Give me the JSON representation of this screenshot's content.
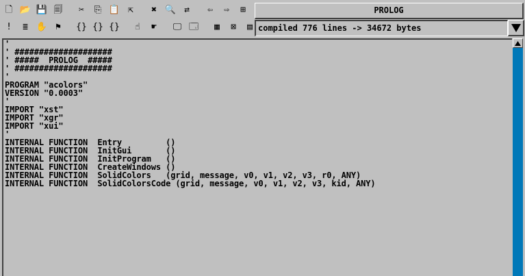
{
  "toolbar": {
    "row1": [
      {
        "name": "new-file-icon",
        "glyph": "🗋"
      },
      {
        "name": "open-folder-icon",
        "glyph": "📂"
      },
      {
        "name": "save-icon",
        "glyph": "💾"
      },
      {
        "name": "save-all-icon",
        "glyph": "🗐"
      },
      {
        "name": "cut-icon",
        "glyph": "✂"
      },
      {
        "name": "copy-icon",
        "glyph": "⎘"
      },
      {
        "name": "paste-icon",
        "glyph": "📋"
      },
      {
        "name": "export-icon",
        "glyph": "⇱"
      },
      {
        "name": "delete-icon",
        "glyph": "✖"
      },
      {
        "name": "find-icon",
        "glyph": "🔍"
      },
      {
        "name": "replace-icon",
        "glyph": "⇄"
      },
      {
        "name": "back-icon",
        "glyph": "⇦"
      },
      {
        "name": "forward-icon",
        "glyph": "⇨"
      },
      {
        "name": "tree-icon",
        "glyph": "⊞"
      }
    ],
    "row2": [
      {
        "name": "abort-icon",
        "glyph": "!"
      },
      {
        "name": "list-icon",
        "glyph": "≣"
      },
      {
        "name": "hand-stop-icon",
        "glyph": "✋"
      },
      {
        "name": "breakpoint-icon",
        "glyph": "⚑"
      },
      {
        "name": "brace-open-icon",
        "glyph": "{}"
      },
      {
        "name": "brace-step-icon",
        "glyph": "{}"
      },
      {
        "name": "brace-close-icon",
        "glyph": "{}"
      },
      {
        "name": "hand-run-icon",
        "glyph": "☝"
      },
      {
        "name": "hand-step-icon",
        "glyph": "☛"
      },
      {
        "name": "monitor-icon",
        "glyph": "🖵"
      },
      {
        "name": "window-icon",
        "glyph": "🗔"
      },
      {
        "name": "grid-icon",
        "glyph": "▦"
      },
      {
        "name": "close-window-icon",
        "glyph": "⊠"
      },
      {
        "name": "document-icon",
        "glyph": "▤"
      }
    ]
  },
  "title": "PROLOG",
  "status": "compiled 776 lines -> 34672 bytes",
  "code_lines": [
    "'",
    "' ####################",
    "' #####  PROLOG  #####",
    "' ####################",
    "'",
    "PROGRAM \"acolors\"",
    "VERSION \"0.0003\"",
    "'",
    "IMPORT \"xst\"",
    "IMPORT \"xgr\"",
    "IMPORT \"xui\"",
    "'",
    "INTERNAL FUNCTION  Entry         ()",
    "INTERNAL FUNCTION  InitGui       ()",
    "INTERNAL FUNCTION  InitProgram   ()",
    "INTERNAL FUNCTION  CreateWindows ()",
    "INTERNAL FUNCTION  SolidColors   (grid, message, v0, v1, v2, v3, r0, ANY)",
    "INTERNAL FUNCTION  SolidColorsCode (grid, message, v0, v1, v2, v3, kid, ANY)"
  ],
  "colors": {
    "background": "#c0c0c0",
    "scrollbar": "#0078b8"
  }
}
